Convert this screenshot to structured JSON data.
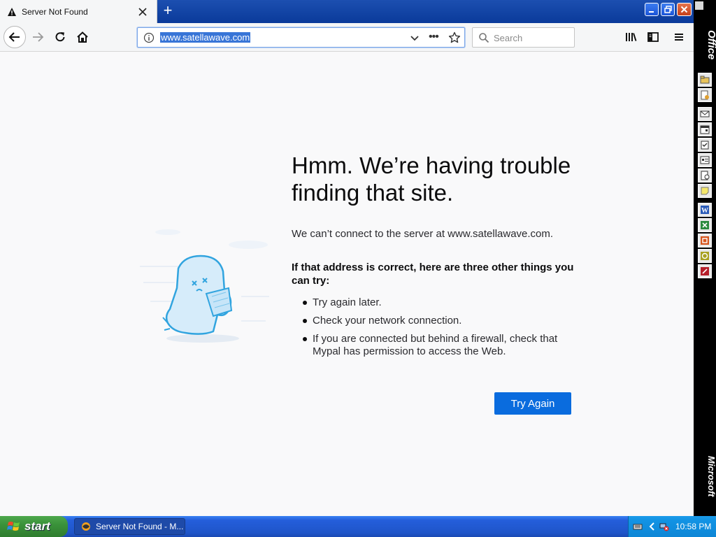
{
  "window": {
    "tab_title": "Server Not Found",
    "new_tab_symbol": "+"
  },
  "navbar": {
    "url": "www.satellawave.com",
    "more_label": "•••",
    "search_placeholder": "Search"
  },
  "error": {
    "title": "Hmm. We’re having trouble finding that site.",
    "description": "We can’t connect to the server at www.satellawave.com.",
    "subtitle": "If that address is correct, here are three other things you can try:",
    "suggestions": [
      "Try again later.",
      "Check your network connection.",
      "If you are connected but behind a firewall, check that Mypal has permission to access the Web."
    ],
    "button_label": "Try Again"
  },
  "office_bar": {
    "top_label": "Office",
    "bottom_label": "Microsoft",
    "icons": [
      "open-office-document-icon",
      "new-office-document-icon",
      "new-message-icon",
      "new-appointment-icon",
      "new-task-icon",
      "new-contact-icon",
      "new-journal-entry-icon",
      "new-note-icon",
      "word-icon",
      "excel-icon",
      "powerpoint-icon",
      "access-icon",
      "publisher-icon"
    ]
  },
  "taskbar": {
    "start_label": "start",
    "task_label": "Server Not Found - M...",
    "clock": "10:58 PM"
  },
  "colors": {
    "accent": "#0a6cde",
    "taskbar": "#245edb",
    "start_green": "#3a923a"
  }
}
